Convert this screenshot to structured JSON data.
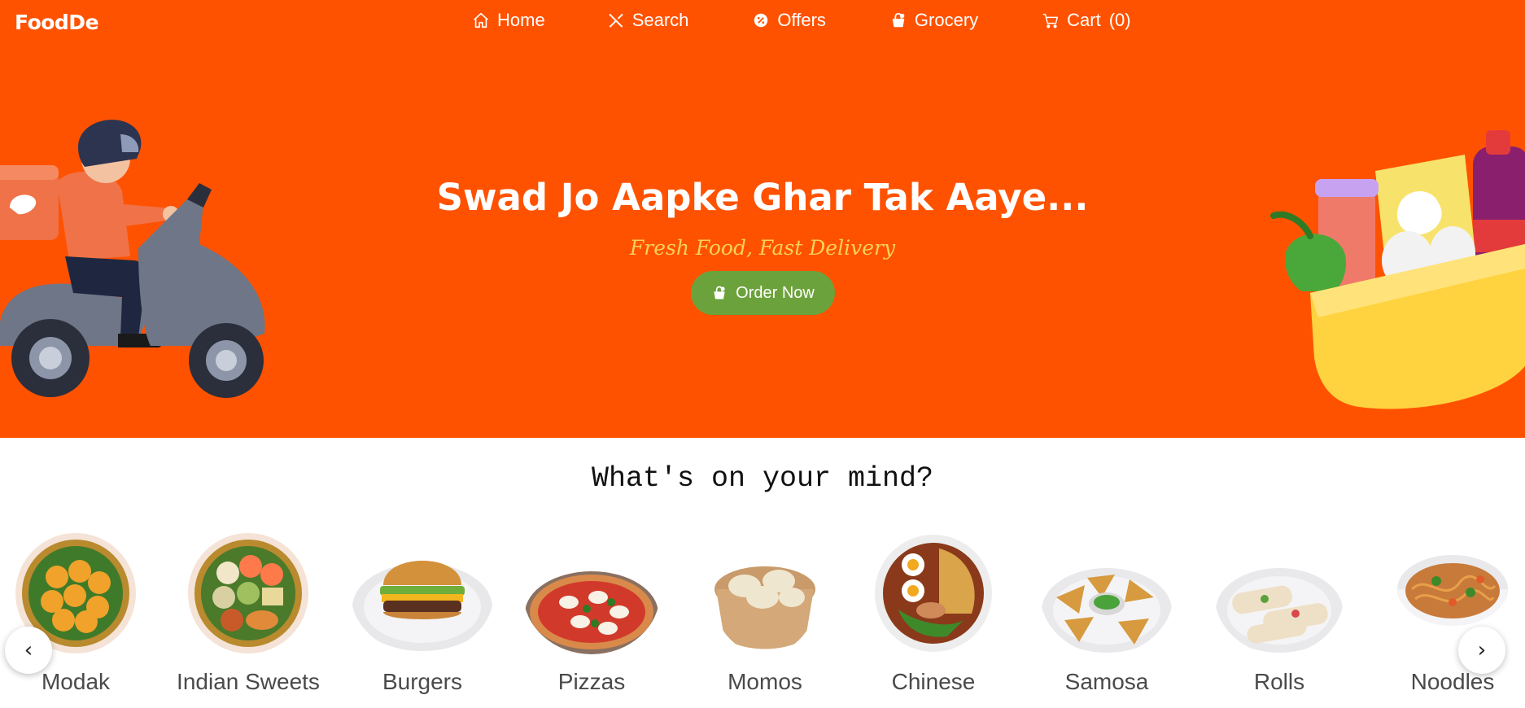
{
  "brand": {
    "name": "FoodDe"
  },
  "nav": {
    "items": [
      {
        "label": "Home",
        "icon": "home-icon"
      },
      {
        "label": "Search",
        "icon": "utensils-icon"
      },
      {
        "label": "Offers",
        "icon": "discount-badge-icon"
      },
      {
        "label": "Grocery",
        "icon": "shopping-bag-icon"
      },
      {
        "label": "Cart",
        "icon": "cart-icon"
      }
    ],
    "cart_count": "(0)"
  },
  "hero": {
    "title": "Swad Jo Aapke Ghar Tak Aaye...",
    "subtitle": "Fresh Food, Fast Delivery",
    "cta_label": "Order Now",
    "cta_icon": "bag-icon",
    "left_illustration": "delivery-scooter-illustration",
    "right_illustration": "grocery-basket-illustration"
  },
  "categories": {
    "title": "What's on your mind?",
    "items": [
      {
        "label": "Modak"
      },
      {
        "label": "Indian Sweets"
      },
      {
        "label": "Burgers"
      },
      {
        "label": "Pizzas"
      },
      {
        "label": "Momos"
      },
      {
        "label": "Chinese"
      },
      {
        "label": "Samosa"
      },
      {
        "label": "Rolls"
      },
      {
        "label": "Noodles"
      }
    ],
    "prev_label": "‹",
    "next_label": "›"
  },
  "colors": {
    "brand_orange": "#ff5200",
    "subtitle_yellow": "#f8d25a",
    "cta_green": "#6ca23b"
  }
}
